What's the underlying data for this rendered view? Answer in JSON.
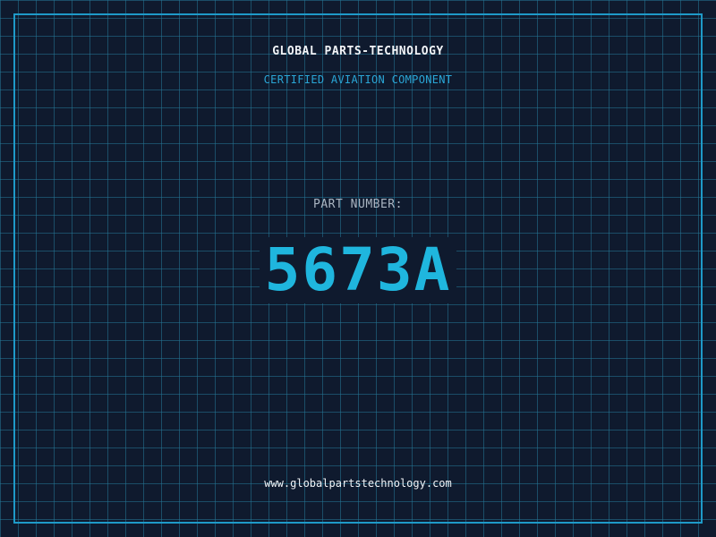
{
  "header": {
    "company_name": "GLOBAL PARTS-TECHNOLOGY",
    "tagline": "CERTIFIED AVIATION COMPONENT"
  },
  "part": {
    "label": "PART NUMBER:",
    "number": "5673A"
  },
  "footer": {
    "website": "www.globalpartstechnology.com"
  },
  "colors": {
    "background": "#0f1a2e",
    "grid": "#247696",
    "frame": "#1e9ac8",
    "accent": "#1fb6de",
    "text": "#f2f5f8",
    "muted": "#aab5c2"
  }
}
